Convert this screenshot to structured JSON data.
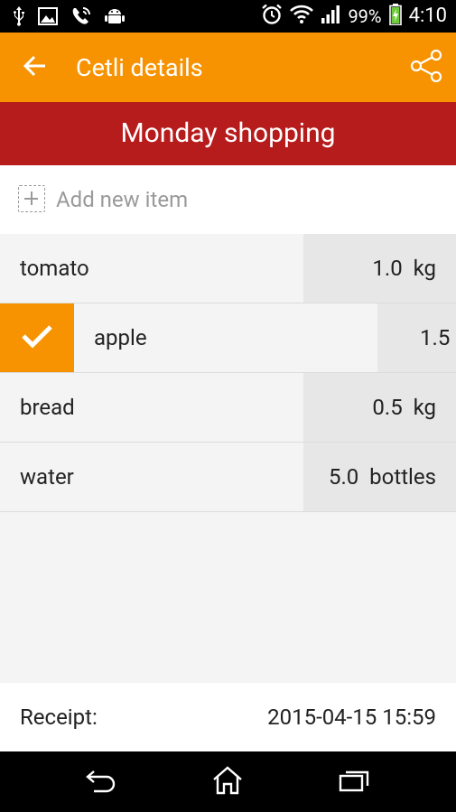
{
  "status_bar": {
    "battery_percent": "99%",
    "time": "4:10",
    "icons": [
      "usb-icon",
      "image-icon",
      "call-icon",
      "android-icon",
      "alarm-icon",
      "wifi-icon",
      "signal-icon",
      "battery-icon"
    ]
  },
  "action_bar": {
    "title": "Cetli details",
    "background": "#f79200"
  },
  "list": {
    "title": "Monday shopping",
    "title_background": "#b71c1c",
    "add_item_label": "Add new item",
    "items": [
      {
        "name": "tomato",
        "quantity": "1.0",
        "unit": "kg",
        "checked": false
      },
      {
        "name": "apple",
        "quantity": "1.5",
        "unit": "",
        "checked": true
      },
      {
        "name": "bread",
        "quantity": "0.5",
        "unit": "kg",
        "checked": false
      },
      {
        "name": "water",
        "quantity": "5.0",
        "unit": "bottles",
        "checked": false
      }
    ]
  },
  "receipt": {
    "label": "Receipt:",
    "value": "2015-04-15 15:59"
  },
  "nav_bar": {
    "icons": [
      "back-nav-icon",
      "home-nav-icon",
      "recents-nav-icon"
    ]
  }
}
